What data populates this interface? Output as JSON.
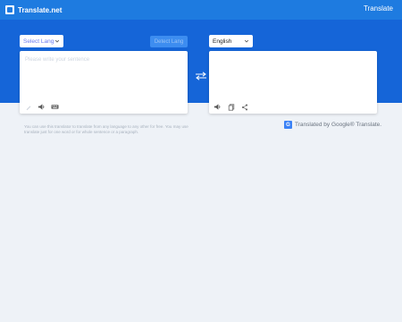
{
  "header": {
    "brand": "Translate.net",
    "nav_link": "Translate"
  },
  "source": {
    "language": "Select Lang",
    "placeholder": "Please write your sentence",
    "detect_label": "Detect Lang"
  },
  "target": {
    "language": "English"
  },
  "footer": {
    "note": "You can use this translator to translate from any language to any other for free. You may use translate just for one word or for whole sentence or a paragraph.",
    "credit": "Translated by Google® Translate.",
    "credit_icon_letter": "G"
  },
  "colors": {
    "topbar": "#1e7be0",
    "hero": "#1565d8",
    "background": "#eef2f7"
  },
  "icons": [
    "pen-icon",
    "speaker-icon",
    "keyboard-icon",
    "swap-icon",
    "copy-icon",
    "share-icon",
    "google-translate-icon",
    "chevron-down-icon"
  ]
}
